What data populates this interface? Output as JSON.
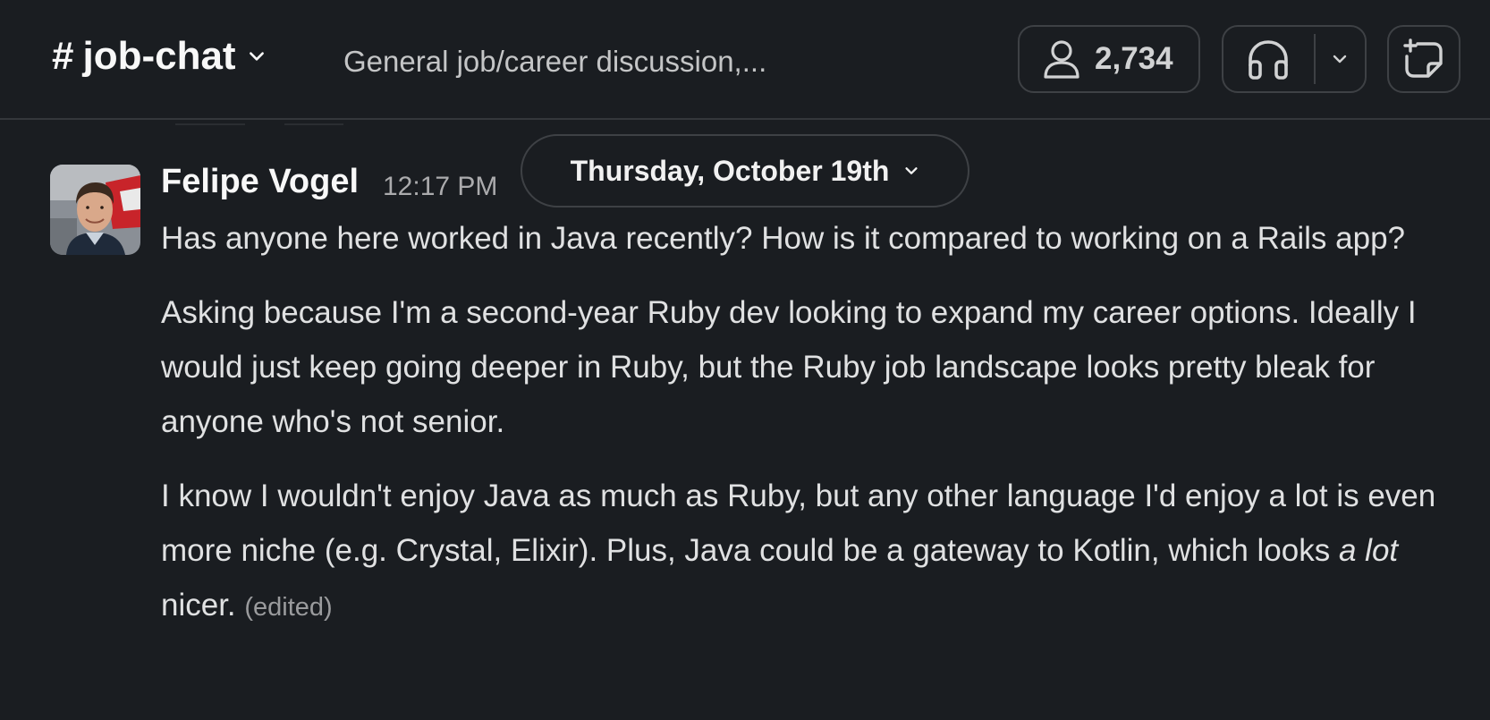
{
  "header": {
    "channel_hash": "#",
    "channel_name": "job-chat",
    "topic": "General job/career discussion,...",
    "member_count": "2,734"
  },
  "date_divider": {
    "label": "Thursday, October 19th"
  },
  "message": {
    "sender": "Felipe Vogel",
    "time": "12:17 PM",
    "paragraphs": [
      "Has anyone here worked in Java recently? How is it compared to working on a Rails app?",
      "Asking because I'm a second-year Ruby dev looking to expand my career options. Ideally I would just keep going deeper in Ruby, but the Ruby job landscape looks pretty bleak for anyone who's not senior.",
      "I know I wouldn't enjoy Java as much as Ruby, but any other language I'd enjoy a lot is even more niche (e.g. Crystal, Elixir). Plus, Java could be a gateway to Kotlin, which looks"
    ],
    "emphasis": "a lot",
    "tail": " nicer.",
    "edited_label": "(edited)"
  },
  "icons": {
    "members": "person-icon",
    "huddle": "headphones-icon",
    "huddle_menu": "chevron-down-icon",
    "canvas": "new-canvas-icon"
  },
  "colors": {
    "background": "#1a1d21",
    "border": "#3e4145",
    "text": "#e0e1e2",
    "muted": "#ababad"
  }
}
